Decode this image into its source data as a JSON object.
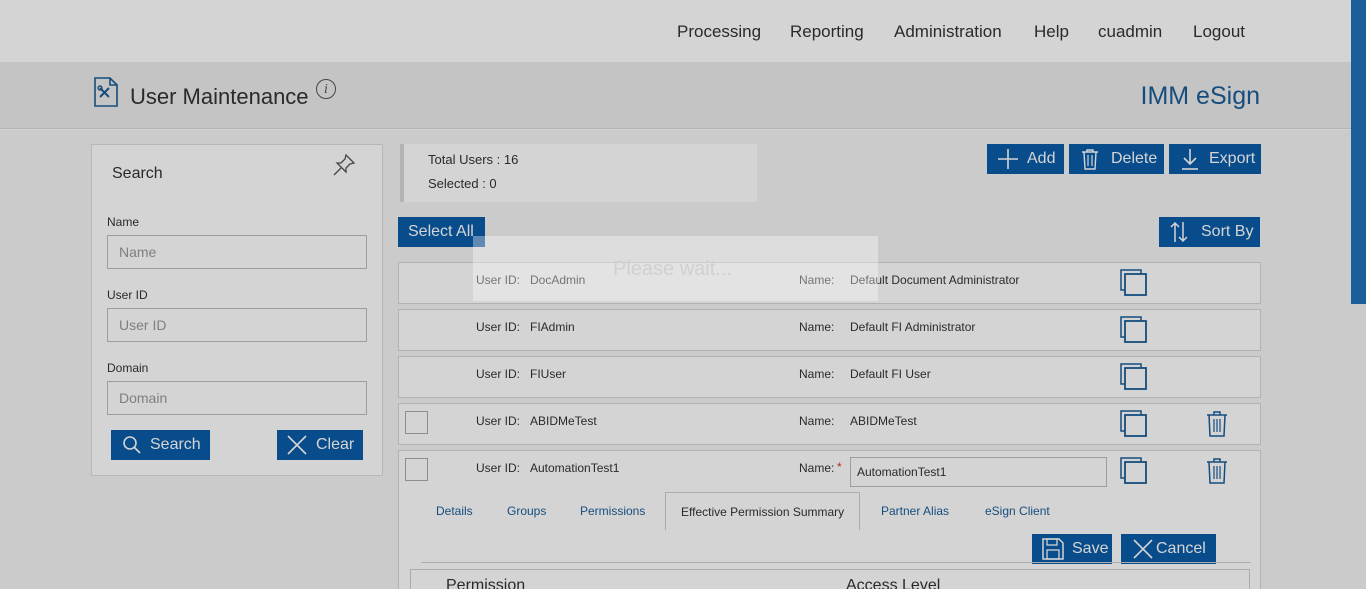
{
  "nav": {
    "items": [
      "Processing",
      "Reporting",
      "Administration",
      "Help",
      "cuadmin",
      "Logout"
    ]
  },
  "header": {
    "title": "User Maintenance",
    "info_glyph": "i",
    "app_name": "IMM eSign"
  },
  "search": {
    "title": "Search",
    "name_label": "Name",
    "name_placeholder": "Name",
    "userid_label": "User ID",
    "userid_placeholder": "User ID",
    "domain_label": "Domain",
    "domain_placeholder": "Domain",
    "search_button": "Search",
    "clear_button": "Clear"
  },
  "summary": {
    "total_label": "Total Users : 16",
    "selected_label": "Selected : 0"
  },
  "toolbar": {
    "add": "Add",
    "delete": "Delete",
    "export": "Export",
    "select_all": "Select All",
    "sort_by": "Sort By"
  },
  "list": {
    "userid_label": "User ID:",
    "name_label": "Name:",
    "required_mark": "*",
    "rows": [
      {
        "user_id": "DocAdmin",
        "name": "Default Document Administrator"
      },
      {
        "user_id": "FIAdmin",
        "name": "Default FI Administrator"
      },
      {
        "user_id": "FIUser",
        "name": "Default FI User"
      },
      {
        "user_id": "ABIDMeTest",
        "name": "ABIDMeTest"
      },
      {
        "user_id": "AutomationTest1",
        "name": "AutomationTest1"
      }
    ]
  },
  "detail": {
    "tabs": [
      "Details",
      "Groups",
      "Permissions",
      "Effective Permission Summary",
      "Partner Alias",
      "eSign Client"
    ],
    "active_tab": "Effective Permission Summary",
    "save": "Save",
    "cancel": "Cancel",
    "col_permission": "Permission",
    "col_access": "Access Level"
  },
  "loading": {
    "text": "Please wait..."
  },
  "colors": {
    "accent": "#0a5ca8",
    "brand_text": "#1a5d98"
  }
}
